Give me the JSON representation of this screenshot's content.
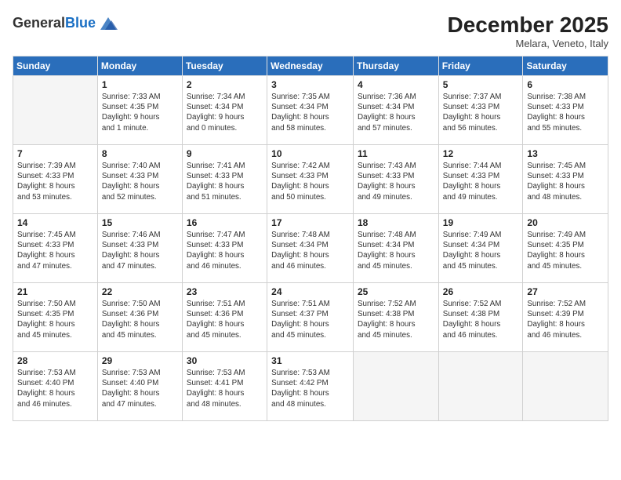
{
  "header": {
    "logo_general": "General",
    "logo_blue": "Blue",
    "month_title": "December 2025",
    "location": "Melara, Veneto, Italy"
  },
  "days_of_week": [
    "Sunday",
    "Monday",
    "Tuesday",
    "Wednesday",
    "Thursday",
    "Friday",
    "Saturday"
  ],
  "weeks": [
    [
      {
        "day": "",
        "info": ""
      },
      {
        "day": "1",
        "info": "Sunrise: 7:33 AM\nSunset: 4:35 PM\nDaylight: 9 hours\nand 1 minute."
      },
      {
        "day": "2",
        "info": "Sunrise: 7:34 AM\nSunset: 4:34 PM\nDaylight: 9 hours\nand 0 minutes."
      },
      {
        "day": "3",
        "info": "Sunrise: 7:35 AM\nSunset: 4:34 PM\nDaylight: 8 hours\nand 58 minutes."
      },
      {
        "day": "4",
        "info": "Sunrise: 7:36 AM\nSunset: 4:34 PM\nDaylight: 8 hours\nand 57 minutes."
      },
      {
        "day": "5",
        "info": "Sunrise: 7:37 AM\nSunset: 4:33 PM\nDaylight: 8 hours\nand 56 minutes."
      },
      {
        "day": "6",
        "info": "Sunrise: 7:38 AM\nSunset: 4:33 PM\nDaylight: 8 hours\nand 55 minutes."
      }
    ],
    [
      {
        "day": "7",
        "info": "Sunrise: 7:39 AM\nSunset: 4:33 PM\nDaylight: 8 hours\nand 53 minutes."
      },
      {
        "day": "8",
        "info": "Sunrise: 7:40 AM\nSunset: 4:33 PM\nDaylight: 8 hours\nand 52 minutes."
      },
      {
        "day": "9",
        "info": "Sunrise: 7:41 AM\nSunset: 4:33 PM\nDaylight: 8 hours\nand 51 minutes."
      },
      {
        "day": "10",
        "info": "Sunrise: 7:42 AM\nSunset: 4:33 PM\nDaylight: 8 hours\nand 50 minutes."
      },
      {
        "day": "11",
        "info": "Sunrise: 7:43 AM\nSunset: 4:33 PM\nDaylight: 8 hours\nand 49 minutes."
      },
      {
        "day": "12",
        "info": "Sunrise: 7:44 AM\nSunset: 4:33 PM\nDaylight: 8 hours\nand 49 minutes."
      },
      {
        "day": "13",
        "info": "Sunrise: 7:45 AM\nSunset: 4:33 PM\nDaylight: 8 hours\nand 48 minutes."
      }
    ],
    [
      {
        "day": "14",
        "info": "Sunrise: 7:45 AM\nSunset: 4:33 PM\nDaylight: 8 hours\nand 47 minutes."
      },
      {
        "day": "15",
        "info": "Sunrise: 7:46 AM\nSunset: 4:33 PM\nDaylight: 8 hours\nand 47 minutes."
      },
      {
        "day": "16",
        "info": "Sunrise: 7:47 AM\nSunset: 4:33 PM\nDaylight: 8 hours\nand 46 minutes."
      },
      {
        "day": "17",
        "info": "Sunrise: 7:48 AM\nSunset: 4:34 PM\nDaylight: 8 hours\nand 46 minutes."
      },
      {
        "day": "18",
        "info": "Sunrise: 7:48 AM\nSunset: 4:34 PM\nDaylight: 8 hours\nand 45 minutes."
      },
      {
        "day": "19",
        "info": "Sunrise: 7:49 AM\nSunset: 4:34 PM\nDaylight: 8 hours\nand 45 minutes."
      },
      {
        "day": "20",
        "info": "Sunrise: 7:49 AM\nSunset: 4:35 PM\nDaylight: 8 hours\nand 45 minutes."
      }
    ],
    [
      {
        "day": "21",
        "info": "Sunrise: 7:50 AM\nSunset: 4:35 PM\nDaylight: 8 hours\nand 45 minutes."
      },
      {
        "day": "22",
        "info": "Sunrise: 7:50 AM\nSunset: 4:36 PM\nDaylight: 8 hours\nand 45 minutes."
      },
      {
        "day": "23",
        "info": "Sunrise: 7:51 AM\nSunset: 4:36 PM\nDaylight: 8 hours\nand 45 minutes."
      },
      {
        "day": "24",
        "info": "Sunrise: 7:51 AM\nSunset: 4:37 PM\nDaylight: 8 hours\nand 45 minutes."
      },
      {
        "day": "25",
        "info": "Sunrise: 7:52 AM\nSunset: 4:38 PM\nDaylight: 8 hours\nand 45 minutes."
      },
      {
        "day": "26",
        "info": "Sunrise: 7:52 AM\nSunset: 4:38 PM\nDaylight: 8 hours\nand 46 minutes."
      },
      {
        "day": "27",
        "info": "Sunrise: 7:52 AM\nSunset: 4:39 PM\nDaylight: 8 hours\nand 46 minutes."
      }
    ],
    [
      {
        "day": "28",
        "info": "Sunrise: 7:53 AM\nSunset: 4:40 PM\nDaylight: 8 hours\nand 46 minutes."
      },
      {
        "day": "29",
        "info": "Sunrise: 7:53 AM\nSunset: 4:40 PM\nDaylight: 8 hours\nand 47 minutes."
      },
      {
        "day": "30",
        "info": "Sunrise: 7:53 AM\nSunset: 4:41 PM\nDaylight: 8 hours\nand 48 minutes."
      },
      {
        "day": "31",
        "info": "Sunrise: 7:53 AM\nSunset: 4:42 PM\nDaylight: 8 hours\nand 48 minutes."
      },
      {
        "day": "",
        "info": ""
      },
      {
        "day": "",
        "info": ""
      },
      {
        "day": "",
        "info": ""
      }
    ]
  ]
}
